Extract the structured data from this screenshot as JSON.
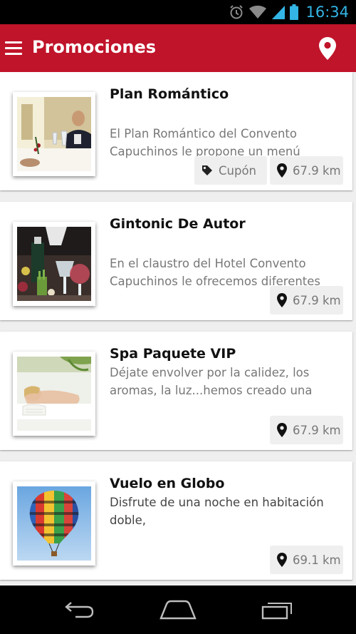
{
  "status_bar": {
    "time": "16:34"
  },
  "app_bar": {
    "title": "Promociones",
    "menu_icon": "hamburger-menu-icon",
    "location_icon": "map-pin-icon"
  },
  "promotions": [
    {
      "title": "Plan Romántico",
      "description": "El Plan Romántico del Convento Capuchinos le propone un menú",
      "coupon_label": "Cupón",
      "distance": "67.9 km"
    },
    {
      "title": "Gintonic De Autor",
      "description": "En el claustro del Hotel Convento Capuchinos le ofrecemos diferentes",
      "distance": "67.9 km"
    },
    {
      "title": "Spa Paquete VIP",
      "description": "Déjate envolver por la calidez, los aromas, la luz...hemos creado una",
      "distance": "67.9 km"
    },
    {
      "title": "Vuelo en Globo",
      "description": "Disfrute de una noche en habitación doble,",
      "distance": "69.1 km"
    }
  ],
  "colors": {
    "app_bar": "#c0142a",
    "status_clock": "#33b5e5",
    "background": "#efefef"
  }
}
